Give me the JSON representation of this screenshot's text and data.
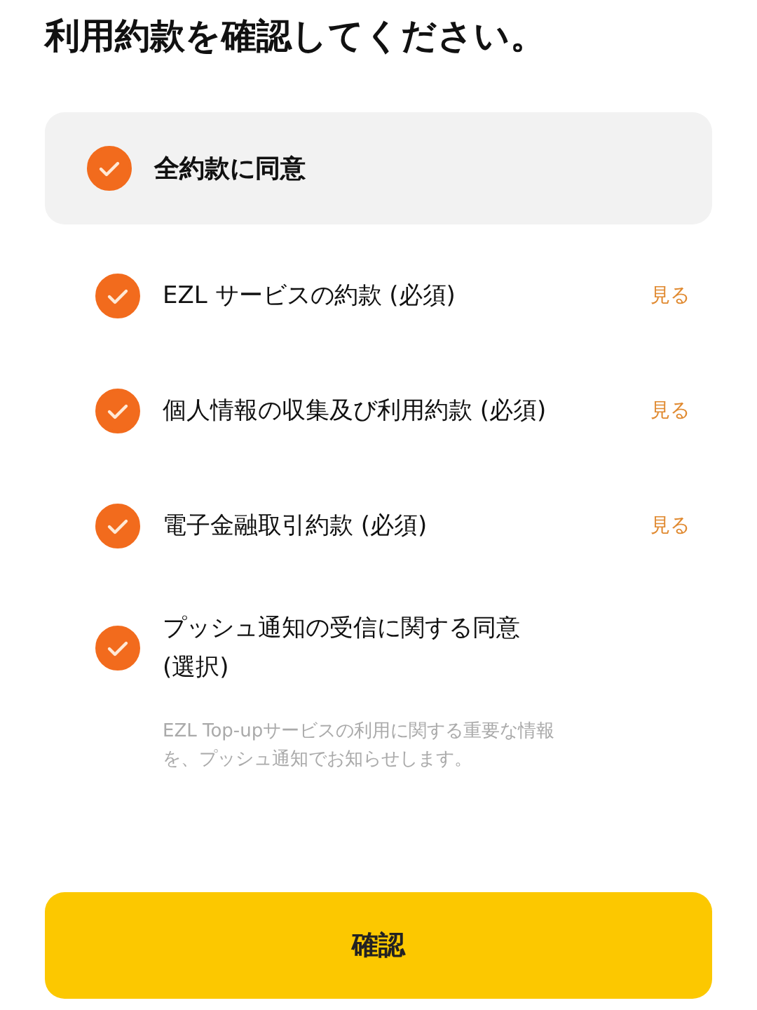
{
  "title": "利用約款を確認してください。",
  "agree_all": {
    "label": "全約款に同意",
    "checked": true
  },
  "terms": [
    {
      "label": "EZL サービスの約款 (必須)",
      "checked": true,
      "link": "見る"
    },
    {
      "label": "個人情報の収集及び利用約款 (必須)",
      "checked": true,
      "link": "見る"
    },
    {
      "label": "電子金融取引約款 (必須)",
      "checked": true,
      "link": "見る"
    },
    {
      "label": "プッシュ通知の受信に関する同意\n(選択)",
      "checked": true
    }
  ],
  "note_lines": [
    "EZL Top-upサービスの利用に関する重要な情報",
    "を、プッシュ通知でお知らせします。"
  ],
  "confirm_button": "確認"
}
